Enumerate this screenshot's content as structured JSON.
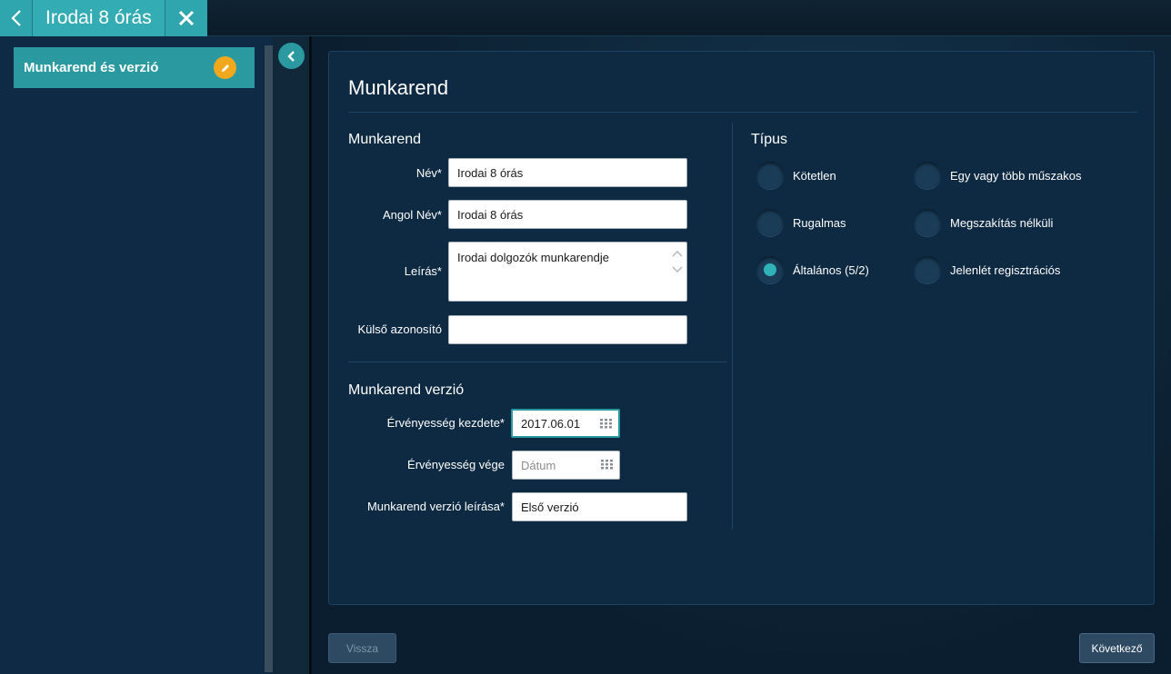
{
  "topbar": {
    "title": "Irodai 8 órás"
  },
  "sidebar": {
    "items": [
      {
        "label": "Munkarend és verzió",
        "active": true
      }
    ]
  },
  "card": {
    "title": "Munkarend",
    "section_munkarend": {
      "title": "Munkarend",
      "fields": {
        "nev": {
          "label": "Név*",
          "value": "Irodai 8 órás"
        },
        "angol_nev": {
          "label": "Angol Név*",
          "value": "Irodai 8 órás"
        },
        "leiras": {
          "label": "Leírás*",
          "value": "Irodai dolgozók munkarendje"
        },
        "kulso_azonosito": {
          "label": "Külső azonosító",
          "value": ""
        }
      }
    },
    "section_verzio": {
      "title": "Munkarend verzió",
      "fields": {
        "kezdete": {
          "label": "Érvényesség kezdete*",
          "value": "2017.06.01"
        },
        "vege": {
          "label": "Érvényesség vége",
          "placeholder": "Dátum"
        },
        "verzio_leiras": {
          "label": "Munkarend verzió leírása*",
          "value": "Első verzió"
        }
      }
    },
    "section_tipus": {
      "title": "Típus",
      "options": [
        {
          "label": "Kötetlen",
          "checked": false
        },
        {
          "label": "Egy vagy több műszakos",
          "checked": false
        },
        {
          "label": "Rugalmas",
          "checked": false
        },
        {
          "label": "Megszakítás nélküli",
          "checked": false
        },
        {
          "label": "Általános (5/2)",
          "checked": true
        },
        {
          "label": "Jelenlét regisztrációs",
          "checked": false
        }
      ]
    }
  },
  "footer": {
    "back_label": "Vissza",
    "next_label": "Következő"
  },
  "colors": {
    "accent": "#2a9aa0",
    "background": "#0d2236",
    "edit_badge": "#f2a81d"
  }
}
